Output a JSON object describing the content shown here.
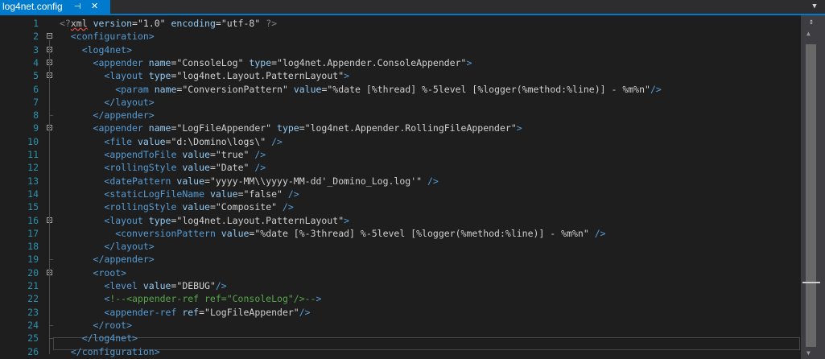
{
  "tab": {
    "title": "log4net.config",
    "pin_glyph": "⊣",
    "close_glyph": "✕"
  },
  "overflow_glyph": "▼",
  "scrollbar": {
    "splitter_glyph": "⇕"
  },
  "editor": {
    "lines": [
      {
        "n": "1",
        "fold": false,
        "segs": [
          [
            "d",
            "<?"
          ],
          [
            "sq",
            "xml"
          ],
          [
            "a",
            " version"
          ],
          [
            "q",
            "=\"1.0\""
          ],
          [
            "a",
            " encoding"
          ],
          [
            "q",
            "=\"utf-8\""
          ],
          [
            "d",
            " ?>"
          ]
        ]
      },
      {
        "n": "2",
        "fold": true,
        "segs": [
          [
            "t",
            "  <"
          ],
          [
            "e",
            "configuration"
          ],
          [
            "t",
            ">"
          ]
        ]
      },
      {
        "n": "3",
        "fold": true,
        "segs": [
          [
            "t",
            "    <"
          ],
          [
            "e",
            "log4net"
          ],
          [
            "t",
            ">"
          ]
        ]
      },
      {
        "n": "4",
        "fold": true,
        "segs": [
          [
            "t",
            "      <"
          ],
          [
            "e",
            "appender"
          ],
          [
            "a",
            " name"
          ],
          [
            "q",
            "=\"ConsoleLog\""
          ],
          [
            "a",
            " type"
          ],
          [
            "q",
            "=\"log4net.Appender.ConsoleAppender\""
          ],
          [
            "t",
            ">"
          ]
        ]
      },
      {
        "n": "5",
        "fold": true,
        "segs": [
          [
            "t",
            "        <"
          ],
          [
            "e",
            "layout"
          ],
          [
            "a",
            " type"
          ],
          [
            "q",
            "=\"log4net.Layout.PatternLayout\""
          ],
          [
            "t",
            ">"
          ]
        ]
      },
      {
        "n": "6",
        "fold": false,
        "segs": [
          [
            "t",
            "          <"
          ],
          [
            "e",
            "param"
          ],
          [
            "a",
            " name"
          ],
          [
            "q",
            "=\"ConversionPattern\""
          ],
          [
            "a",
            " value"
          ],
          [
            "q",
            "=\"%date [%thread] %-5level [%logger(%method:%line)] - %m%n\""
          ],
          [
            "t",
            "/>"
          ]
        ]
      },
      {
        "n": "7",
        "fold": false,
        "segs": [
          [
            "t",
            "        </"
          ],
          [
            "e",
            "layout"
          ],
          [
            "t",
            ">"
          ]
        ]
      },
      {
        "n": "8",
        "fold": false,
        "segs": [
          [
            "t",
            "      </"
          ],
          [
            "e",
            "appender"
          ],
          [
            "t",
            ">"
          ]
        ]
      },
      {
        "n": "9",
        "fold": true,
        "segs": [
          [
            "t",
            "      <"
          ],
          [
            "e",
            "appender"
          ],
          [
            "a",
            " name"
          ],
          [
            "q",
            "=\"LogFileAppender\""
          ],
          [
            "a",
            " type"
          ],
          [
            "q",
            "=\"log4net.Appender.RollingFileAppender\""
          ],
          [
            "t",
            ">"
          ]
        ]
      },
      {
        "n": "10",
        "fold": false,
        "segs": [
          [
            "t",
            "        <"
          ],
          [
            "e",
            "file"
          ],
          [
            "a",
            " value"
          ],
          [
            "q",
            "=\"d:\\Domino\\logs\\\""
          ],
          [
            "t",
            " />"
          ]
        ]
      },
      {
        "n": "11",
        "fold": false,
        "segs": [
          [
            "t",
            "        <"
          ],
          [
            "e",
            "appendToFile"
          ],
          [
            "a",
            " value"
          ],
          [
            "q",
            "=\"true\""
          ],
          [
            "t",
            " />"
          ]
        ]
      },
      {
        "n": "12",
        "fold": false,
        "segs": [
          [
            "t",
            "        <"
          ],
          [
            "e",
            "rollingStyle"
          ],
          [
            "a",
            " value"
          ],
          [
            "q",
            "=\"Date\""
          ],
          [
            "t",
            " />"
          ]
        ]
      },
      {
        "n": "13",
        "fold": false,
        "segs": [
          [
            "t",
            "        <"
          ],
          [
            "e",
            "datePattern"
          ],
          [
            "a",
            " value"
          ],
          [
            "q",
            "=\"yyyy-MM\\\\yyyy-MM-dd'_Domino_Log.log'\""
          ],
          [
            "t",
            " />"
          ]
        ]
      },
      {
        "n": "14",
        "fold": false,
        "segs": [
          [
            "t",
            "        <"
          ],
          [
            "e",
            "staticLogFileName"
          ],
          [
            "a",
            " value"
          ],
          [
            "q",
            "=\"false\""
          ],
          [
            "t",
            " />"
          ]
        ]
      },
      {
        "n": "15",
        "fold": false,
        "segs": [
          [
            "t",
            "        <"
          ],
          [
            "e",
            "rollingStyle"
          ],
          [
            "a",
            " value"
          ],
          [
            "q",
            "=\"Composite\""
          ],
          [
            "t",
            " />"
          ]
        ]
      },
      {
        "n": "16",
        "fold": true,
        "segs": [
          [
            "t",
            "        <"
          ],
          [
            "e",
            "layout"
          ],
          [
            "a",
            " type"
          ],
          [
            "q",
            "=\"log4net.Layout.PatternLayout\""
          ],
          [
            "t",
            ">"
          ]
        ]
      },
      {
        "n": "17",
        "fold": false,
        "segs": [
          [
            "t",
            "          <"
          ],
          [
            "e",
            "conversionPattern"
          ],
          [
            "a",
            " value"
          ],
          [
            "q",
            "=\"%date [%-3thread] %-5level [%logger(%method:%line)] - %m%n\""
          ],
          [
            "t",
            " />"
          ]
        ]
      },
      {
        "n": "18",
        "fold": false,
        "segs": [
          [
            "t",
            "        </"
          ],
          [
            "e",
            "layout"
          ],
          [
            "t",
            ">"
          ]
        ]
      },
      {
        "n": "19",
        "fold": false,
        "segs": [
          [
            "t",
            "      </"
          ],
          [
            "e",
            "appender"
          ],
          [
            "t",
            ">"
          ]
        ]
      },
      {
        "n": "20",
        "fold": true,
        "segs": [
          [
            "t",
            "      <"
          ],
          [
            "e",
            "root"
          ],
          [
            "t",
            ">"
          ]
        ]
      },
      {
        "n": "21",
        "fold": false,
        "segs": [
          [
            "t",
            "        <"
          ],
          [
            "e",
            "level"
          ],
          [
            "a",
            " value"
          ],
          [
            "q",
            "=\"DEBUG\""
          ],
          [
            "t",
            "/>"
          ]
        ]
      },
      {
        "n": "22",
        "fold": false,
        "segs": [
          [
            "t",
            "        <"
          ],
          [
            "c",
            "!--<appender-ref ref=\"ConsoleLog\"/>--"
          ],
          [
            "t",
            ">"
          ]
        ]
      },
      {
        "n": "23",
        "fold": false,
        "segs": [
          [
            "t",
            "        <"
          ],
          [
            "e",
            "appender-ref"
          ],
          [
            "a",
            " ref"
          ],
          [
            "q",
            "=\"LogFileAppender\""
          ],
          [
            "t",
            "/>"
          ]
        ]
      },
      {
        "n": "24",
        "fold": false,
        "segs": [
          [
            "t",
            "      </"
          ],
          [
            "e",
            "root"
          ],
          [
            "t",
            ">"
          ]
        ]
      },
      {
        "n": "25",
        "fold": false,
        "segs": [
          [
            "t",
            "    </"
          ],
          [
            "e",
            "log4net"
          ],
          [
            "t",
            ">"
          ]
        ]
      },
      {
        "n": "26",
        "fold": false,
        "segs": [
          [
            "t",
            "  </"
          ],
          [
            "e",
            "configuration"
          ],
          [
            "t",
            ">"
          ]
        ]
      }
    ]
  }
}
